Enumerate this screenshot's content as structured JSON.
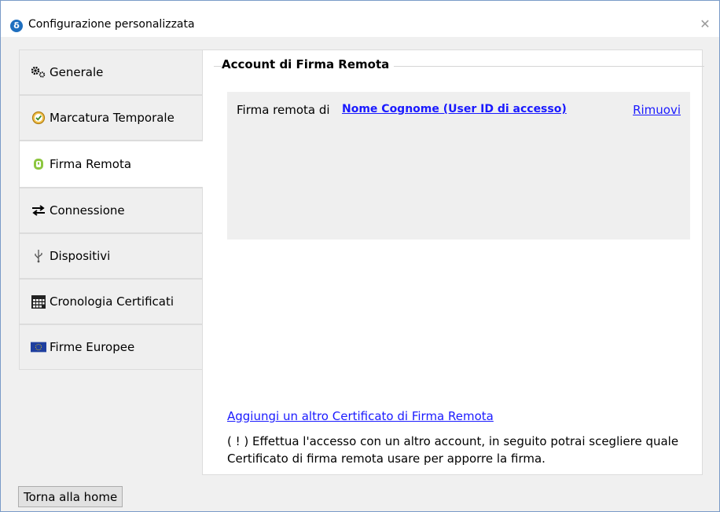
{
  "window": {
    "title": "Configurazione personalizzata",
    "app_icon_glyph": "δ",
    "close_glyph": "✕"
  },
  "sidebar": {
    "items": [
      {
        "label": "Generale",
        "icon": "gears-icon"
      },
      {
        "label": "Marcatura Temporale",
        "icon": "clock-check-icon"
      },
      {
        "label": "Firma Remota",
        "icon": "remote-sign-icon",
        "active": true
      },
      {
        "label": "Connessione",
        "icon": "arrows-exchange-icon"
      },
      {
        "label": "Dispositivi",
        "icon": "usb-icon"
      },
      {
        "label": "Cronologia Certificati",
        "icon": "calendar-icon"
      },
      {
        "label": "Firme Europee",
        "icon": "eu-flag-icon"
      }
    ]
  },
  "content": {
    "group_title": "Account di Firma Remota",
    "account": {
      "prefix": "Firma remota di",
      "name": "Nome Cognome (User ID di accesso)",
      "remove_label": "Rimuovi"
    },
    "add_link": "Aggiungi un altro Certificato di Firma Remota",
    "note": "( ! ) Effettua l'accesso con un altro account, in seguito potrai scegliere quale Certificato di firma remota usare per apporre la firma."
  },
  "footer": {
    "home_button": "Torna alla home"
  },
  "colors": {
    "link": "#1a1aff",
    "app_icon": "#1f6fbf",
    "panel_bg": "#efefef",
    "window_bg": "#f0f0f0"
  }
}
